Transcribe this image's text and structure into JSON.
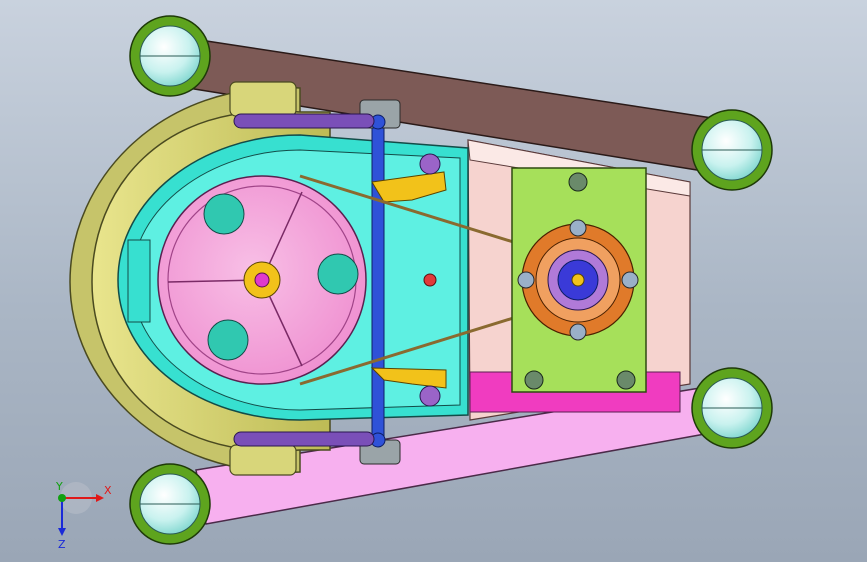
{
  "viewport": {
    "kind": "CAD 3D model viewport",
    "background_top": "#c9d2de",
    "background_bottom": "#9aa6b6"
  },
  "triad": {
    "x_label": "X",
    "y_label": "Y",
    "z_label": "Z",
    "x_color": "#e01818",
    "y_color": "#10a010",
    "z_color": "#1a2ad8"
  },
  "part_colors": {
    "pulley": "#f29bd6",
    "housing": "#37e0d0",
    "guard": "#d8d67a",
    "motor_plate": "#a6e05a",
    "top_belt": "#7d5a56",
    "bottom_link": "#f7b0ef",
    "wheel_tire": "#5ea41e",
    "wheel_hub": "#c9f2ef",
    "shaft": "#2f52d8",
    "bracket": "#f2c21a",
    "handle": "#7a4fb8"
  },
  "icons": [
    "coordinate-triad-icon",
    "pulley-icon",
    "wheel-icon",
    "motor-icon",
    "bolt-icon"
  ]
}
